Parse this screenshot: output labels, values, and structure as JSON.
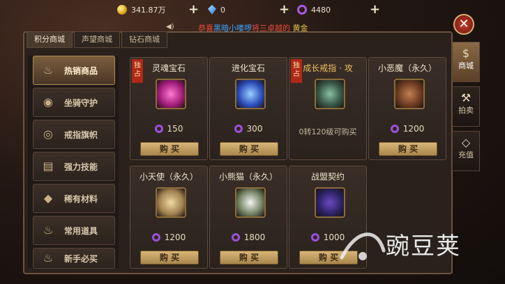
{
  "resources": {
    "gold": "341.87万",
    "blue": "0",
    "purple": "4480"
  },
  "announcement": {
    "p1": "恭喜",
    "p2": "黑暗小喽啰",
    "p3": "将",
    "p4": "三卓越的",
    "p5": " 黄金"
  },
  "tabs": [
    "积分商城",
    "声望商城",
    "钻石商城"
  ],
  "categories": [
    "热销商品",
    "坐骑守护",
    "戒指旗帜",
    "强力技能",
    "稀有材料",
    "常用道具",
    "新手必买"
  ],
  "items": [
    {
      "name": "灵魂宝石",
      "price": "150",
      "exclusive": true
    },
    {
      "name": "进化宝石",
      "price": "300",
      "exclusive": false
    },
    {
      "name": "成长戒指 · 攻",
      "note": "0转120级可购买",
      "exclusive": true
    },
    {
      "name": "小恶魔（永久）",
      "price": "1200",
      "exclusive": false
    },
    {
      "name": "小天使（永久）",
      "price": "1200",
      "exclusive": false
    },
    {
      "name": "小熊猫（永久）",
      "price": "1800",
      "exclusive": false
    },
    {
      "name": "战盟契约",
      "price": "1000",
      "exclusive": false
    }
  ],
  "buy_label": "购 买",
  "exclusive_label": "独占",
  "right_nav": [
    "商城",
    "拍卖",
    "充值"
  ],
  "watermark": "豌豆荚"
}
